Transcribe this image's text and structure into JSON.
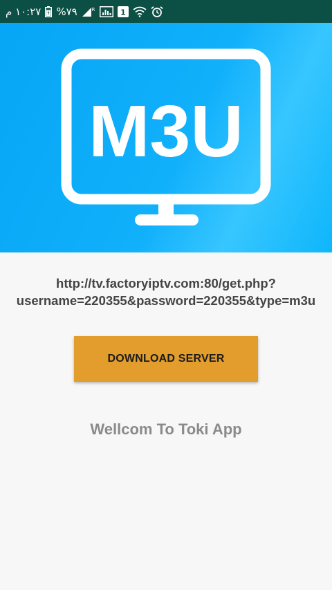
{
  "status_bar": {
    "time": "١٠:٢٧ م",
    "battery_percent": "%٧٩",
    "signal_roaming": "R",
    "sim_slot": "1",
    "icons": [
      "alarm-icon",
      "wifi-icon",
      "sim-1-icon",
      "data-usage-icon",
      "signal-icon",
      "battery-icon"
    ]
  },
  "banner": {
    "logo_text": "M3U",
    "logo_icon": "tv-monitor-icon",
    "colors": {
      "background": "#11b0fb",
      "logo": "#ffffff"
    }
  },
  "main": {
    "url": "http://tv.factoryiptv.com:80/get.php?username=220355&password=220355&type=m3u",
    "download_label": "DOWNLOAD SERVER",
    "welcome_text": "Wellcom To Toki App"
  },
  "colors": {
    "status_bar": "#0b4f45",
    "button": "#e29d2c",
    "url_text": "#444444",
    "welcome_text": "#8a8a8a"
  }
}
